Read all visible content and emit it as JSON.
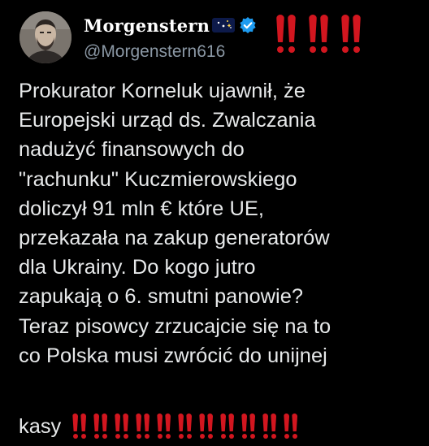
{
  "author": {
    "display_name": "Morgenstern",
    "emoji_icon": "night-sky-icon",
    "verified": true,
    "verified_color": "#1d9bf0",
    "handle": "@Morgenstern616"
  },
  "header_exclamations": {
    "count": 3,
    "icon": "double-exclamation-icon",
    "color": "#d2161f"
  },
  "tweet": {
    "text": "Prokurator Korneluk ujawnił, że\nEuropejski urząd ds. Zwalczania\nnadużyć finansowych do\n\"rachunku\" Kuczmierowskiego\ndoliczył 91 mln € które UE,\nprzekazała na zakup generatorów\ndla Ukrainy. Do kogo jutro\nzapukają o 6. smutni panowie?\nTeraz pisowcy zrzucajcie się na to\nco Polska musi zwrócić do unijnej",
    "last_word": "kasy",
    "trailing_exclamations": {
      "count": 11,
      "icon": "double-exclamation-icon",
      "color": "#d2161f"
    }
  },
  "colors": {
    "background": "#000000",
    "text": "#e7e9ea",
    "handle": "#8b98a5",
    "accent": "#d2161f"
  }
}
